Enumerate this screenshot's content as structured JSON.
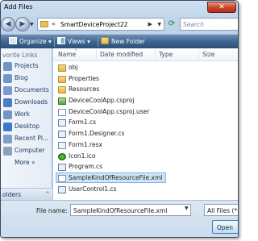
{
  "window": {
    "title": "Add Files",
    "close_label": "✕"
  },
  "nav": {
    "back_glyph": "◀",
    "forward_glyph": "▶",
    "address_chevron": "«",
    "address": "SmartDeviceProject22",
    "address_arrow": "▶",
    "search_placeholder": "Search",
    "refresh_glyph": "⟳"
  },
  "toolbar": {
    "organize": "Organize ▾",
    "views": "Views ▾",
    "new_folder": "New Folder"
  },
  "favorites": {
    "header": "vorite Links",
    "items": [
      {
        "label": "Projects",
        "icon": "folder-icon",
        "color": "#6f96c4"
      },
      {
        "label": "Blog",
        "icon": "folder-icon",
        "color": "#6f96c4"
      },
      {
        "label": "Documents",
        "icon": "documents-icon",
        "color": "#7c9ad0"
      },
      {
        "label": "Downloads",
        "icon": "downloads-icon",
        "color": "#4a7fc2"
      },
      {
        "label": "Work",
        "icon": "folder-icon",
        "color": "#6f96c4"
      },
      {
        "label": "Desktop",
        "icon": "desktop-icon",
        "color": "#3c79c9"
      },
      {
        "label": "Recent Pl...",
        "icon": "recent-places-icon",
        "color": "#7f9fc8"
      },
      {
        "label": "Computer",
        "icon": "computer-icon",
        "color": "#8aa2bf"
      },
      {
        "label": "More »",
        "icon": "none",
        "color": ""
      }
    ],
    "folders_label": "olders",
    "folders_chevron": "^"
  },
  "columns": {
    "name": "Name",
    "date": "Date modified",
    "type": "Type",
    "size": "Size",
    "sort_glyph": "^"
  },
  "files": [
    {
      "name": "obj",
      "icon": "folder-icon"
    },
    {
      "name": "Properties",
      "icon": "folder-icon"
    },
    {
      "name": "Resources",
      "icon": "folder-icon"
    },
    {
      "name": "DeviceCoolApp.csproj",
      "icon": "csproj-icon"
    },
    {
      "name": "DeviceCoolApp.csproj.user",
      "icon": "document-icon"
    },
    {
      "name": "Form1.cs",
      "icon": "cs-file-icon"
    },
    {
      "name": "Form1.Designer.cs",
      "icon": "cs-file-icon"
    },
    {
      "name": "Form1.resx",
      "icon": "resx-file-icon"
    },
    {
      "name": "Icon1.ico",
      "icon": "ico-file-icon"
    },
    {
      "name": "Program.cs",
      "icon": "cs-file-icon"
    },
    {
      "name": "SampleKindOfResourceFile.xml",
      "icon": "xml-file-icon",
      "selected": true
    },
    {
      "name": "UserControl1.cs",
      "icon": "cs-file-icon"
    }
  ],
  "bottom": {
    "file_name_label": "File name:",
    "file_name_value": "SampleKindOfResourceFile.xml",
    "filter_value": "All Files (*.*)",
    "open_label": "Open"
  }
}
